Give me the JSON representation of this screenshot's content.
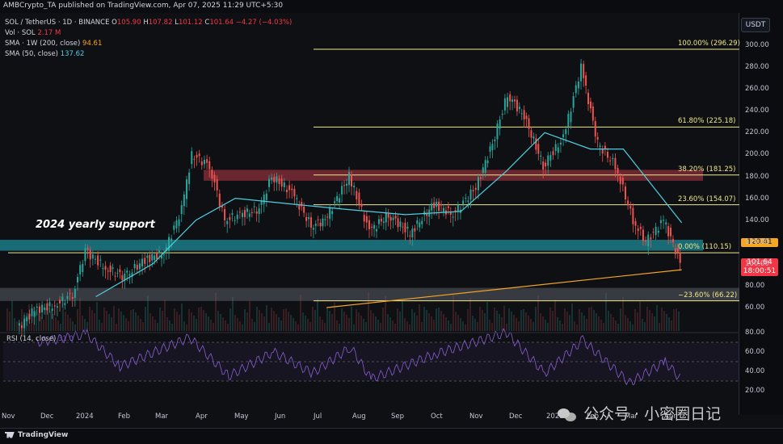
{
  "header": {
    "publisher": "AMBCrypto_TA published on TradingView.com, Apr 07, 2025 11:29 UTC+5:30"
  },
  "legend": {
    "symbol": "SOL / TetherUS · 1D · BINANCE",
    "o_label": "O",
    "o_value": "105.90",
    "h_label": "H",
    "h_value": "107.82",
    "l_label": "L",
    "l_value": "101.12",
    "c_label": "C",
    "c_value": "101.64",
    "change": "−4.27 (−4.03%)",
    "vol_label": "Vol · SOL",
    "vol_value": "2.17 M",
    "sma200_label": "SMA · 1W (200, close)",
    "sma200_value": "94.61",
    "sma50_label": "SMA (50, close)",
    "sma50_value": "137.62",
    "rsi_label": "RSI (14, close)",
    "rsi_value": "31.0"
  },
  "axis": {
    "currency": "USDT",
    "last_price": "101.64",
    "countdown": "18:00:51",
    "level_tag": "120.41"
  },
  "annotation": "2024 yearly support",
  "watermark": "公众号 · 小密圈日记",
  "footer": {
    "brand": "TradingView"
  },
  "colors": {
    "up": "#26a69a",
    "down": "#ef5350",
    "sma50": "#4dd0e1",
    "sma200": "#f5a623",
    "fib": "#f0e68c",
    "rsi": "#7e57c2",
    "zone_support": "#1e8a96",
    "zone_resistance": "#8b2f3a"
  },
  "chart_data": {
    "type": "candlestick",
    "price_axis_ticks": [
      300,
      280,
      260,
      240,
      220,
      200,
      180,
      160,
      140,
      120,
      100,
      80,
      60
    ],
    "rsi_axis_ticks": [
      80,
      60,
      40,
      20
    ],
    "x_tick_labels": [
      "Nov",
      "Dec",
      "2024",
      "Feb",
      "Mar",
      "Apr",
      "May",
      "Jun",
      "Jul",
      "Aug",
      "Sep",
      "Oct",
      "Nov",
      "Dec",
      "2025",
      "Feb",
      "Mar",
      "Apr"
    ],
    "fib_levels": [
      {
        "label": "100.00% (296.29)",
        "price": 296.29
      },
      {
        "label": "61.80% (225.18)",
        "price": 225.18
      },
      {
        "label": "38.20% (181.25)",
        "price": 181.25
      },
      {
        "label": "23.60% (154.07)",
        "price": 154.07
      },
      {
        "label": "0.00% (110.15)",
        "price": 110.15
      },
      {
        "label": "−23.60% (66.22)",
        "price": 66.22
      }
    ],
    "zones": [
      {
        "name": "resistance",
        "low": 176,
        "high": 186
      },
      {
        "name": "support",
        "low": 112,
        "high": 122
      },
      {
        "name": "lower",
        "low": 66,
        "high": 78
      }
    ],
    "close_series": [
      {
        "date": "2023-11-01",
        "close": 40
      },
      {
        "date": "2023-11-15",
        "close": 58
      },
      {
        "date": "2023-12-01",
        "close": 62
      },
      {
        "date": "2023-12-15",
        "close": 72
      },
      {
        "date": "2023-12-25",
        "close": 112
      },
      {
        "date": "2024-01-10",
        "close": 96
      },
      {
        "date": "2024-01-25",
        "close": 88
      },
      {
        "date": "2024-02-10",
        "close": 104
      },
      {
        "date": "2024-02-25",
        "close": 110
      },
      {
        "date": "2024-03-10",
        "close": 150
      },
      {
        "date": "2024-03-18",
        "close": 200
      },
      {
        "date": "2024-04-01",
        "close": 190
      },
      {
        "date": "2024-04-13",
        "close": 140
      },
      {
        "date": "2024-04-25",
        "close": 145
      },
      {
        "date": "2024-05-10",
        "close": 150
      },
      {
        "date": "2024-05-20",
        "close": 180
      },
      {
        "date": "2024-06-05",
        "close": 165
      },
      {
        "date": "2024-06-20",
        "close": 135
      },
      {
        "date": "2024-07-01",
        "close": 140
      },
      {
        "date": "2024-07-20",
        "close": 180
      },
      {
        "date": "2024-08-05",
        "close": 130
      },
      {
        "date": "2024-08-20",
        "close": 145
      },
      {
        "date": "2024-09-06",
        "close": 128
      },
      {
        "date": "2024-09-25",
        "close": 155
      },
      {
        "date": "2024-10-10",
        "close": 145
      },
      {
        "date": "2024-10-28",
        "close": 170
      },
      {
        "date": "2024-11-10",
        "close": 210
      },
      {
        "date": "2024-11-22",
        "close": 255
      },
      {
        "date": "2024-12-05",
        "close": 235
      },
      {
        "date": "2024-12-20",
        "close": 190
      },
      {
        "date": "2025-01-05",
        "close": 215
      },
      {
        "date": "2025-01-19",
        "close": 280
      },
      {
        "date": "2025-02-01",
        "close": 210
      },
      {
        "date": "2025-02-15",
        "close": 190
      },
      {
        "date": "2025-03-01",
        "close": 140
      },
      {
        "date": "2025-03-11",
        "close": 120
      },
      {
        "date": "2025-03-25",
        "close": 140
      },
      {
        "date": "2025-04-07",
        "close": 101.64
      }
    ],
    "sma50_series": [
      {
        "date": "2024-01-01",
        "close": 70
      },
      {
        "date": "2024-02-15",
        "close": 100
      },
      {
        "date": "2024-03-20",
        "close": 140
      },
      {
        "date": "2024-04-20",
        "close": 160
      },
      {
        "date": "2024-06-01",
        "close": 155
      },
      {
        "date": "2024-07-15",
        "close": 150
      },
      {
        "date": "2024-09-01",
        "close": 145
      },
      {
        "date": "2024-10-15",
        "close": 148
      },
      {
        "date": "2024-11-20",
        "close": 185
      },
      {
        "date": "2024-12-20",
        "close": 220
      },
      {
        "date": "2025-01-25",
        "close": 205
      },
      {
        "date": "2025-02-20",
        "close": 205
      },
      {
        "date": "2025-04-07",
        "close": 137.62
      }
    ],
    "sma200w_series": [
      {
        "date": "2024-07-01",
        "close": 60
      },
      {
        "date": "2025-04-07",
        "close": 94.61
      }
    ],
    "rsi_series": [
      {
        "date": "2023-11-15",
        "rsi": 70
      },
      {
        "date": "2023-12-25",
        "rsi": 78
      },
      {
        "date": "2024-01-20",
        "rsi": 45
      },
      {
        "date": "2024-03-15",
        "rsi": 75
      },
      {
        "date": "2024-04-15",
        "rsi": 35
      },
      {
        "date": "2024-05-20",
        "rsi": 60
      },
      {
        "date": "2024-06-20",
        "rsi": 38
      },
      {
        "date": "2024-07-20",
        "rsi": 65
      },
      {
        "date": "2024-08-05",
        "rsi": 32
      },
      {
        "date": "2024-09-25",
        "rsi": 58
      },
      {
        "date": "2024-11-20",
        "rsi": 80
      },
      {
        "date": "2024-12-20",
        "rsi": 38
      },
      {
        "date": "2025-01-19",
        "rsi": 72
      },
      {
        "date": "2025-02-25",
        "rsi": 28
      },
      {
        "date": "2025-03-25",
        "rsi": 50
      },
      {
        "date": "2025-04-07",
        "rsi": 31.0
      }
    ]
  }
}
